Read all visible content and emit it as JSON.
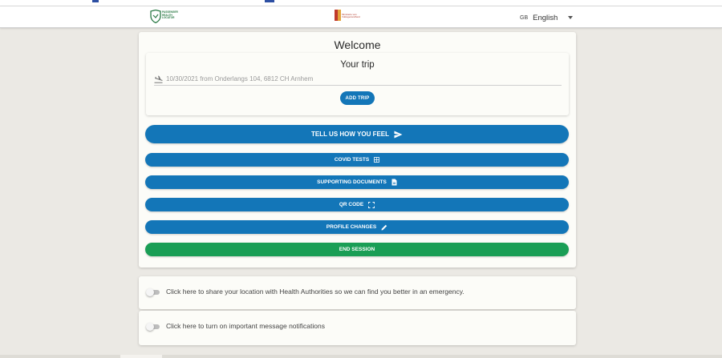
{
  "header": {
    "left_logo_text": "PASSENGER HEALTH LOCATOR",
    "center_logo_text": "Ministerie van Volksgezondheid",
    "language_code": "GB",
    "language": "English"
  },
  "main": {
    "welcome": "Welcome",
    "trip": {
      "title": "Your trip",
      "entry": "10/30/2021 from Onderlangs 104, 6812 CH Arnhem",
      "add_button": "ADD TRIP"
    },
    "buttons": {
      "feel": "TELL US HOW YOU FEEL",
      "covid": "COVID TESTS",
      "documents": "SUPPORTING DOCUMENTS",
      "qr": "QR CODE",
      "profile": "PROFILE CHANGES",
      "end": "END SESSION"
    }
  },
  "toggles": {
    "location": "Click here to share your location with Health Authorities so we can find you better in an emergency.",
    "notifications": "Click here to turn on important message notifications"
  },
  "icons": {
    "feel": "send-icon",
    "covid": "test-grid-icon",
    "documents": "document-icon",
    "qr": "qr-scan-icon",
    "profile": "pencil-icon",
    "trip": "airplane-icon"
  },
  "colors": {
    "primary": "#1376b8",
    "end_session": "#1a9e55",
    "background": "#ebe9e4",
    "card": "#fcfcf8"
  }
}
